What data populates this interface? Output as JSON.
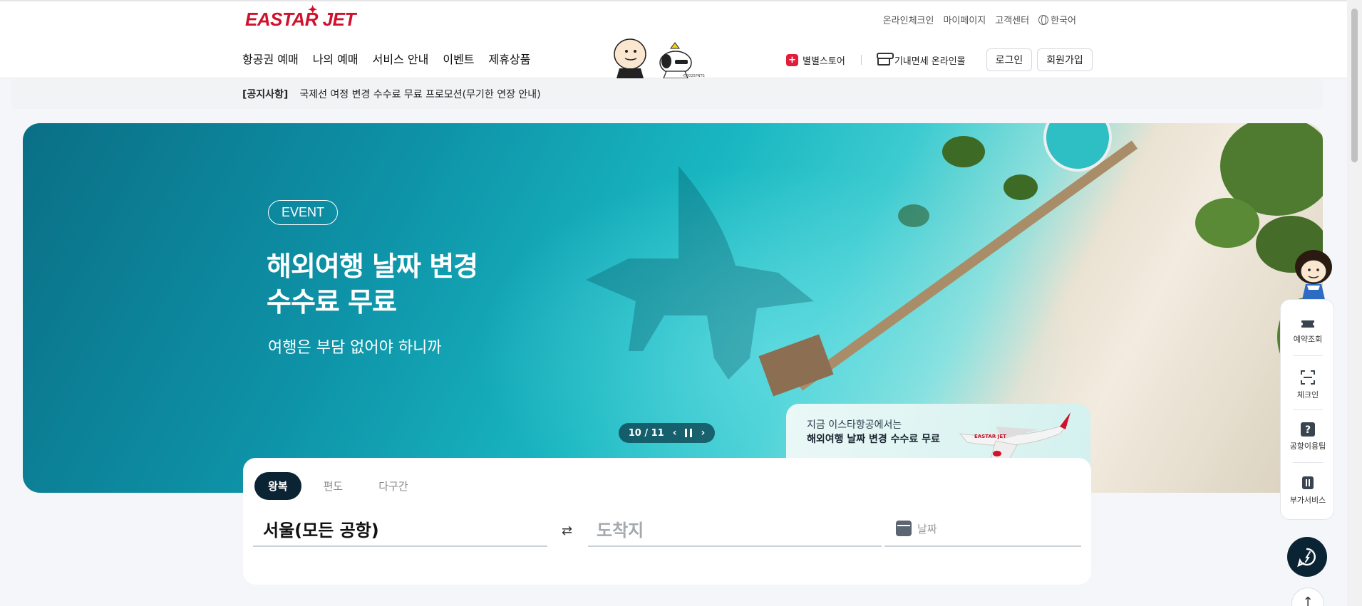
{
  "brand": {
    "logo": "EASTAR JET",
    "accent": "#d0112b",
    "dark": "#0b2434"
  },
  "utility_nav": {
    "online_checkin": "온라인체크인",
    "mypage": "마이페이지",
    "customer_center": "고객센터",
    "language": "한국어"
  },
  "main_nav": [
    "항공권 예매",
    "나의 예매",
    "서비스 안내",
    "이벤트",
    "제휴상품"
  ],
  "peanuts_copyright": "©2025PNTS",
  "right_nav": {
    "store": "별별스토어",
    "store_icon_glyph": "+",
    "duty_free": "기내면세 온라인몰",
    "login": "로그인",
    "signup": "회원가입"
  },
  "notice": {
    "tag": "[공지사항]",
    "text": "국제선 여정 변경 수수료 무료 프로모션(무기한 연장 안내)"
  },
  "hero": {
    "badge": "EVENT",
    "title_line1": "해외여행 날짜 변경",
    "title_line2": "수수료 무료",
    "subtitle": "여행은 부담 없어야 하니까",
    "pager": "10 / 11",
    "prev_icon": "‹",
    "next_icon": "›",
    "promo_line1": "지금 이스타항공에서는",
    "promo_line2": "해외여행 날짜 변경 수수료 무료"
  },
  "booking": {
    "tabs": [
      "왕복",
      "편도",
      "다구간"
    ],
    "active_tab": "왕복",
    "origin": "서울(모든 공항)",
    "swap_icon": "⇄",
    "destination_placeholder": "도착지",
    "date_placeholder": "날짜"
  },
  "quick_menu": [
    "예약조회",
    "체크인",
    "공항이용팁",
    "부가서비스"
  ],
  "scroll_top_icon": "↑"
}
